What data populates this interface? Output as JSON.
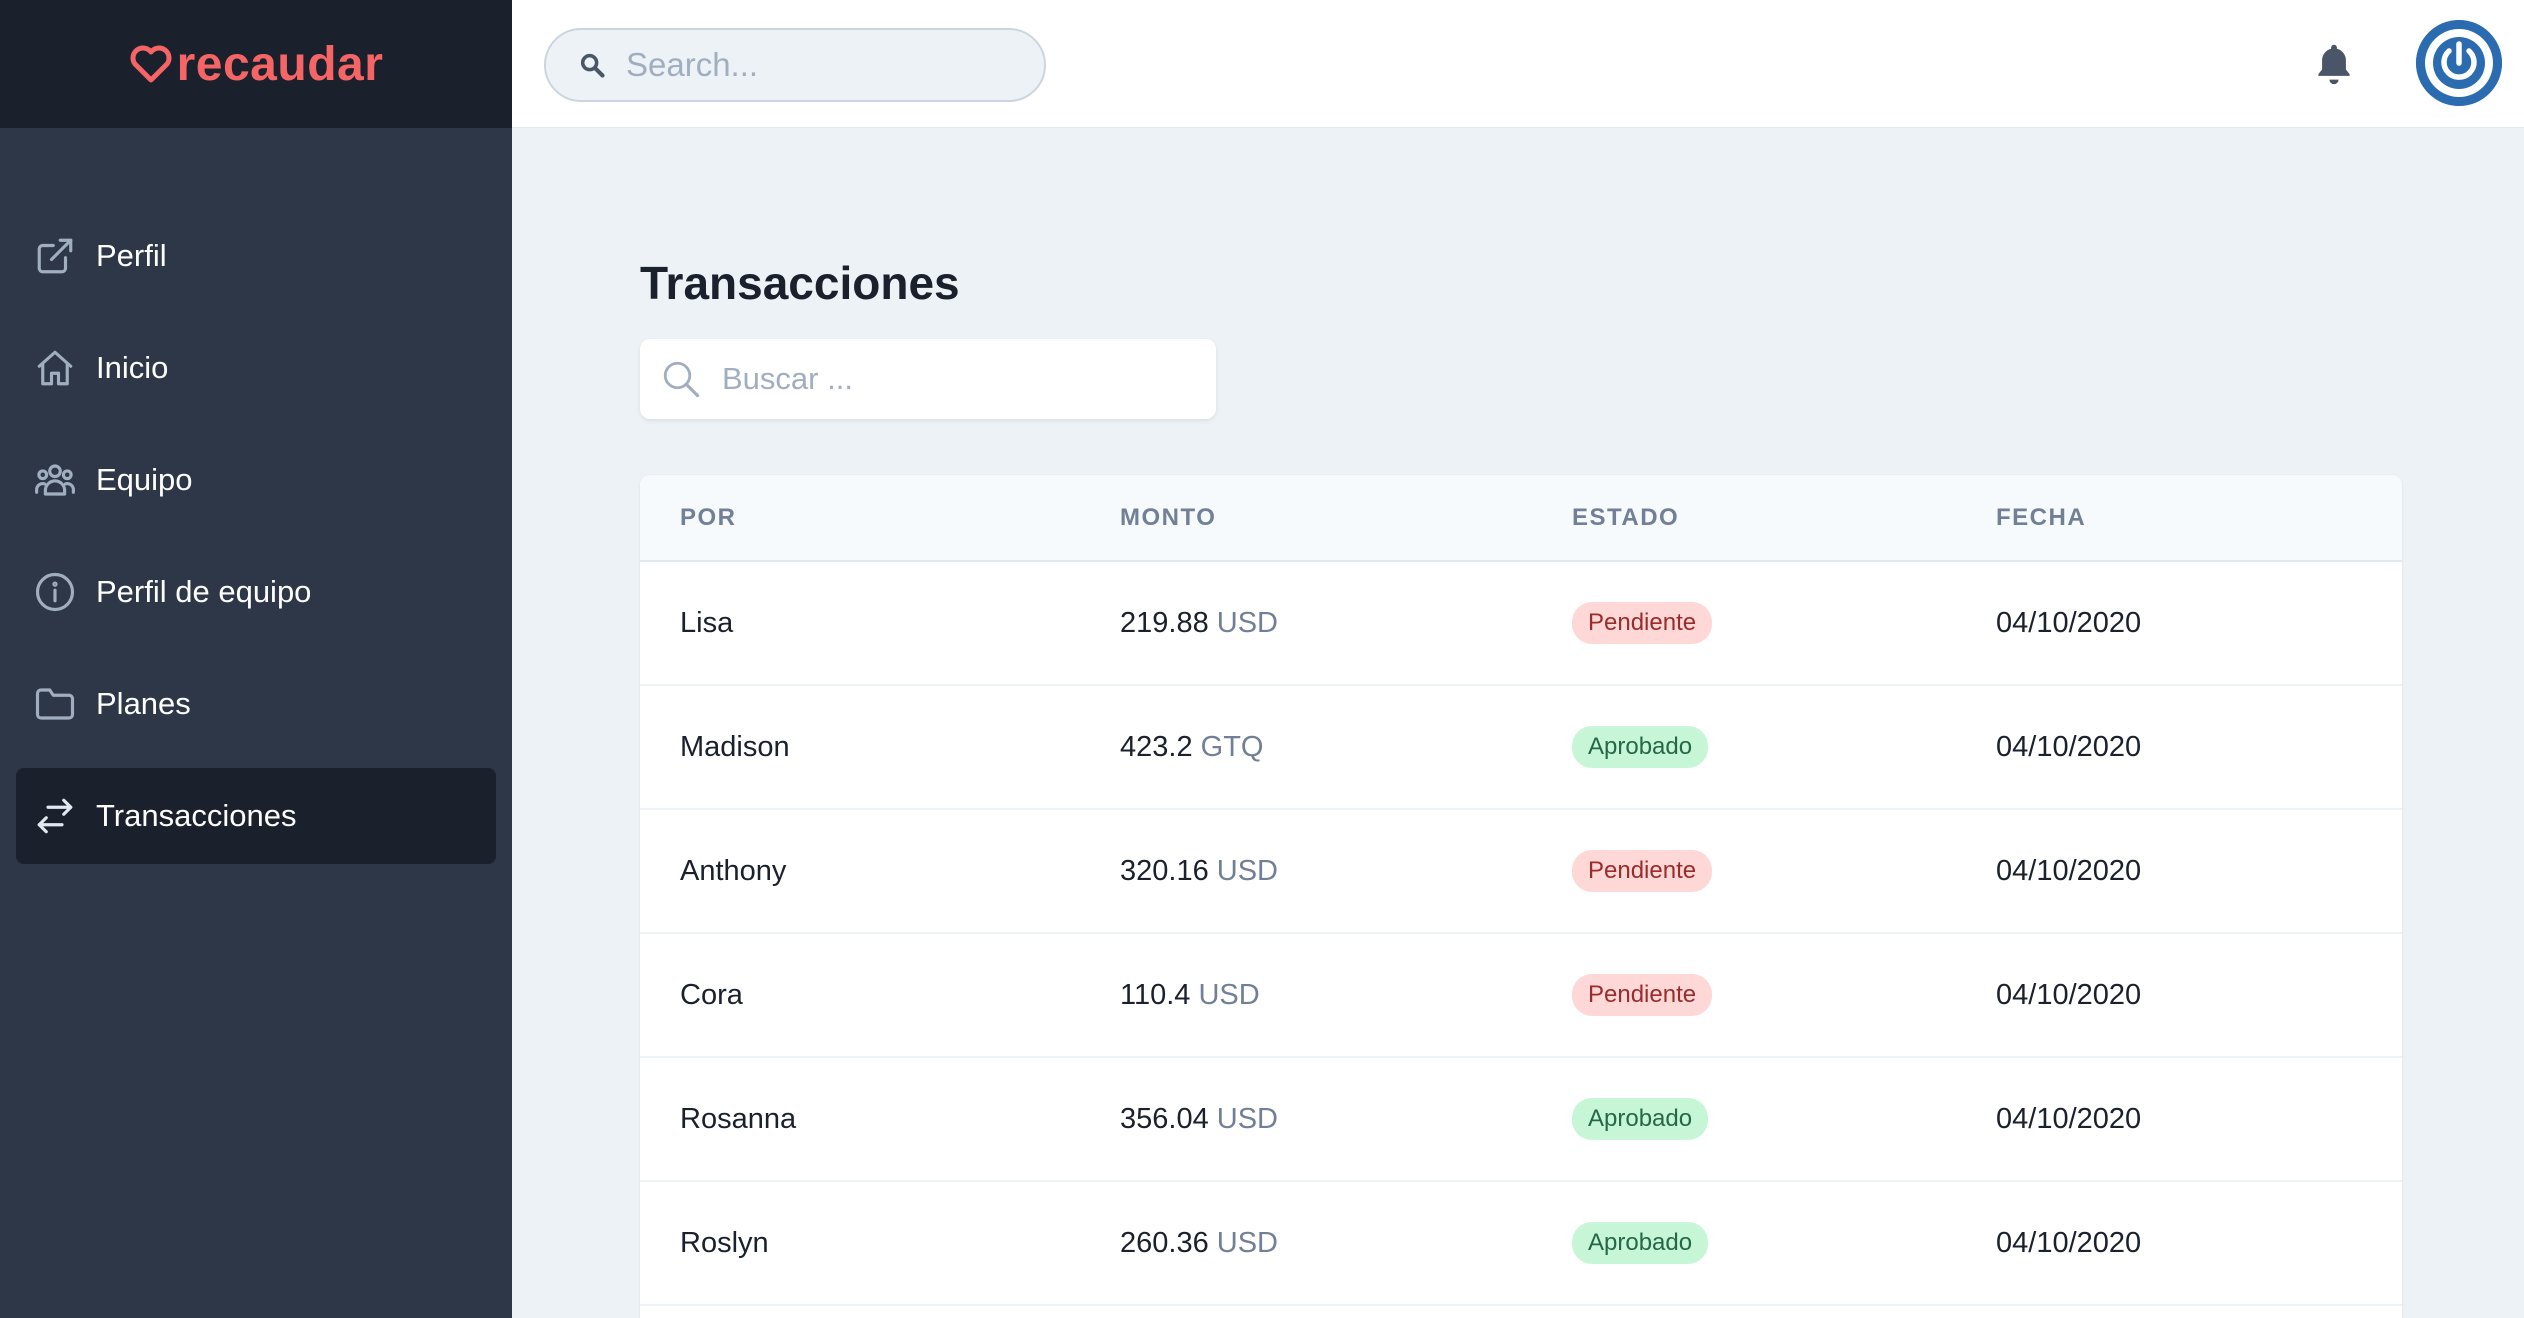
{
  "app": {
    "logo_text": "recaudar",
    "brand_color": "#f56565"
  },
  "topbar": {
    "search_placeholder": "Search..."
  },
  "sidebar": {
    "items": [
      {
        "label": "Perfil",
        "icon": "external-link-icon",
        "active": false
      },
      {
        "label": "Inicio",
        "icon": "home-icon",
        "active": false
      },
      {
        "label": "Equipo",
        "icon": "users-icon",
        "active": false
      },
      {
        "label": "Perfil de equipo",
        "icon": "info-icon",
        "active": false
      },
      {
        "label": "Planes",
        "icon": "folder-icon",
        "active": false
      },
      {
        "label": "Transacciones",
        "icon": "switch-arrows-icon",
        "active": true
      }
    ]
  },
  "main": {
    "title": "Transacciones",
    "search_placeholder": "Buscar ...",
    "table": {
      "headers": {
        "por": "POR",
        "monto": "MONTO",
        "estado": "ESTADO",
        "fecha": "FECHA"
      },
      "rows": [
        {
          "por": "Lisa",
          "amount": "219.88",
          "currency": "USD",
          "status": "Pendiente",
          "status_type": "pending",
          "fecha": "04/10/2020"
        },
        {
          "por": "Madison",
          "amount": "423.2",
          "currency": "GTQ",
          "status": "Aprobado",
          "status_type": "approved",
          "fecha": "04/10/2020"
        },
        {
          "por": "Anthony",
          "amount": "320.16",
          "currency": "USD",
          "status": "Pendiente",
          "status_type": "pending",
          "fecha": "04/10/2020"
        },
        {
          "por": "Cora",
          "amount": "110.4",
          "currency": "USD",
          "status": "Pendiente",
          "status_type": "pending",
          "fecha": "04/10/2020"
        },
        {
          "por": "Rosanna",
          "amount": "356.04",
          "currency": "USD",
          "status": "Aprobado",
          "status_type": "approved",
          "fecha": "04/10/2020"
        },
        {
          "por": "Roslyn",
          "amount": "260.36",
          "currency": "USD",
          "status": "Aprobado",
          "status_type": "approved",
          "fecha": "04/10/2020"
        }
      ]
    }
  },
  "colors": {
    "sidebar_bg": "#2d3748",
    "sidebar_dark": "#1a202c",
    "pending_bg": "#fed7d7",
    "pending_text": "#9b2c2c",
    "approved_bg": "#c6f6d5",
    "approved_text": "#276749",
    "avatar": "#2b6cb0"
  }
}
